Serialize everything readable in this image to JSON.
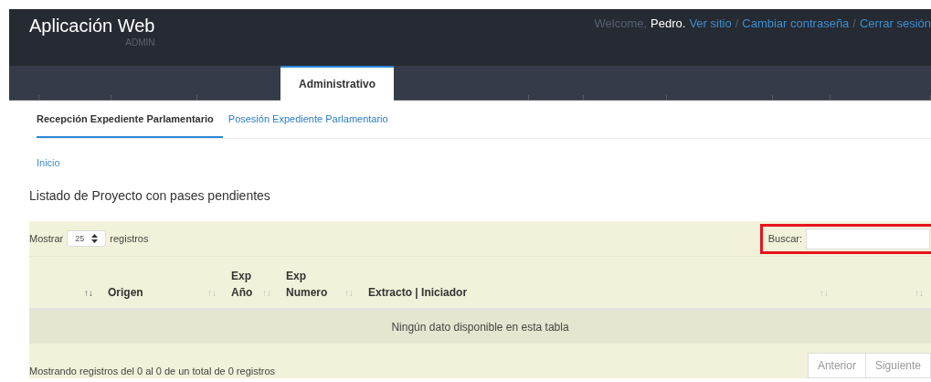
{
  "header": {
    "title": "Aplicación Web",
    "subtitle": "ADMIN",
    "welcome": "Welcome,",
    "user": "Pedro.",
    "links": [
      {
        "label": "Ver sitio"
      },
      {
        "label": "Cambiar contraseña"
      },
      {
        "label": "Cerrar sesión"
      }
    ],
    "separator": "/"
  },
  "nav_tabs": [
    {
      "label": "Administrativo",
      "selected": true
    }
  ],
  "sub_tabs": [
    {
      "label": "Recepción Expediente Parlamentario",
      "selected": true
    },
    {
      "label": "Posesión Expediente Parlamentario",
      "selected": false
    }
  ],
  "breadcrumb": "Inicio",
  "page_title": "Listado de Proyecto con pases pendientes",
  "table": {
    "length_label_before": "Mostrar",
    "length_value": "25",
    "length_label_after": "registros",
    "search_label": "Buscar:",
    "search_highlighted": true,
    "columns": [
      {
        "sort": "↑↓",
        "sorted": true
      },
      {
        "lines": [
          "Origen"
        ],
        "sort": "↑↓",
        "sorted": false
      },
      {
        "lines": [
          "Exp",
          "Año"
        ],
        "sort": "↑↓",
        "sorted": false
      },
      {
        "lines": [
          "Exp",
          "Numero"
        ],
        "sort": "↑↓",
        "sorted": false
      },
      {
        "lines": [
          "Extracto | Iniciador"
        ],
        "sort": "↑↓",
        "sorted": false
      },
      {
        "sort": "↑↓",
        "sorted": false
      }
    ],
    "empty_message": "Ningún dato disponible en esta tabla",
    "info": "Mostrando registros del 0 al 0 de un total de 0 registros",
    "pagination": [
      {
        "label": "Anterior",
        "disabled": true
      },
      {
        "label": "Siguiente",
        "disabled": true
      }
    ]
  }
}
